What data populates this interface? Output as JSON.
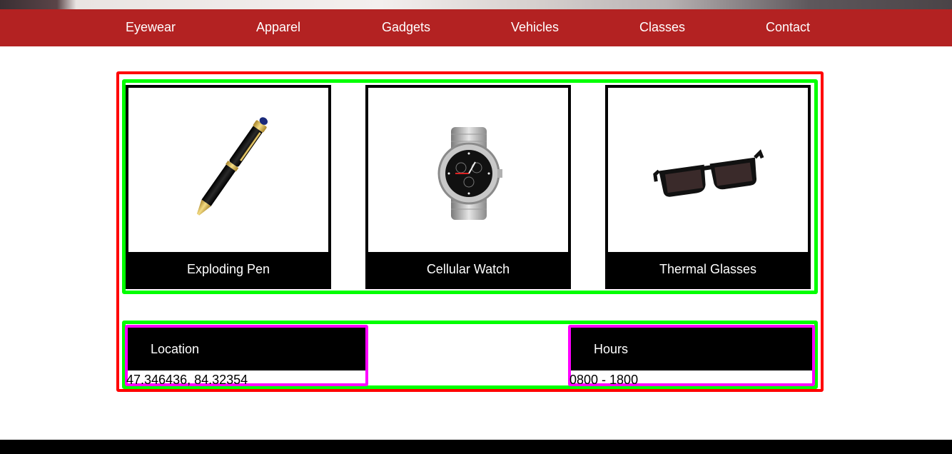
{
  "nav": {
    "items": [
      {
        "label": "Eyewear"
      },
      {
        "label": "Apparel"
      },
      {
        "label": "Gadgets"
      },
      {
        "label": "Vehicles"
      },
      {
        "label": "Classes"
      },
      {
        "label": "Contact"
      }
    ]
  },
  "products": [
    {
      "name": "Exploding Pen",
      "icon": "pen-icon"
    },
    {
      "name": "Cellular Watch",
      "icon": "watch-icon"
    },
    {
      "name": "Thermal Glasses",
      "icon": "sunglasses-icon"
    }
  ],
  "info": {
    "location": {
      "label": "Location",
      "value": "47.346436, 84.32354"
    },
    "hours": {
      "label": "Hours",
      "value": "0800 - 1800"
    }
  },
  "colors": {
    "nav_bg": "#b32222",
    "outer_border": "#ff0000",
    "section_border": "#00ff00",
    "panel_border": "#ff00ff"
  }
}
